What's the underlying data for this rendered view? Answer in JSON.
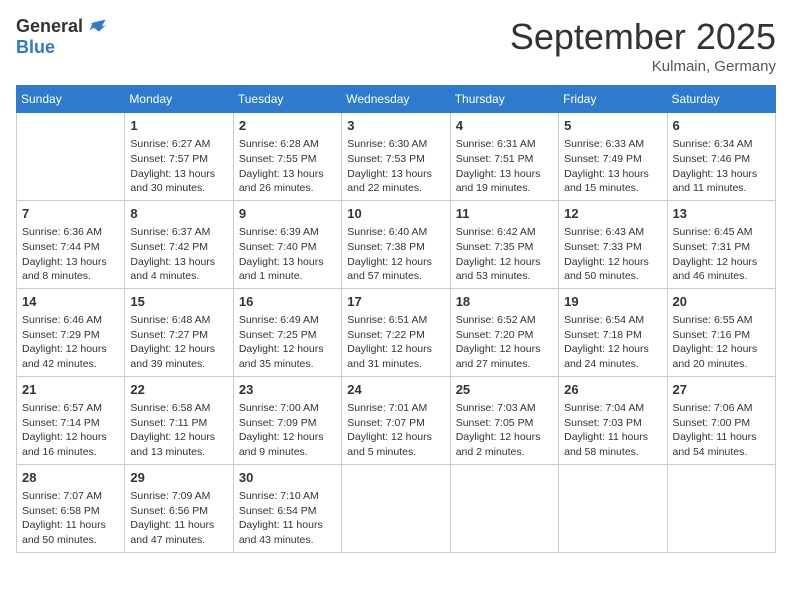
{
  "header": {
    "logo_general": "General",
    "logo_blue": "Blue",
    "month_title": "September 2025",
    "location": "Kulmain, Germany"
  },
  "weekdays": [
    "Sunday",
    "Monday",
    "Tuesday",
    "Wednesday",
    "Thursday",
    "Friday",
    "Saturday"
  ],
  "weeks": [
    [
      {
        "day": "",
        "info": ""
      },
      {
        "day": "1",
        "info": "Sunrise: 6:27 AM\nSunset: 7:57 PM\nDaylight: 13 hours and 30 minutes."
      },
      {
        "day": "2",
        "info": "Sunrise: 6:28 AM\nSunset: 7:55 PM\nDaylight: 13 hours and 26 minutes."
      },
      {
        "day": "3",
        "info": "Sunrise: 6:30 AM\nSunset: 7:53 PM\nDaylight: 13 hours and 22 minutes."
      },
      {
        "day": "4",
        "info": "Sunrise: 6:31 AM\nSunset: 7:51 PM\nDaylight: 13 hours and 19 minutes."
      },
      {
        "day": "5",
        "info": "Sunrise: 6:33 AM\nSunset: 7:49 PM\nDaylight: 13 hours and 15 minutes."
      },
      {
        "day": "6",
        "info": "Sunrise: 6:34 AM\nSunset: 7:46 PM\nDaylight: 13 hours and 11 minutes."
      }
    ],
    [
      {
        "day": "7",
        "info": "Sunrise: 6:36 AM\nSunset: 7:44 PM\nDaylight: 13 hours and 8 minutes."
      },
      {
        "day": "8",
        "info": "Sunrise: 6:37 AM\nSunset: 7:42 PM\nDaylight: 13 hours and 4 minutes."
      },
      {
        "day": "9",
        "info": "Sunrise: 6:39 AM\nSunset: 7:40 PM\nDaylight: 13 hours and 1 minute."
      },
      {
        "day": "10",
        "info": "Sunrise: 6:40 AM\nSunset: 7:38 PM\nDaylight: 12 hours and 57 minutes."
      },
      {
        "day": "11",
        "info": "Sunrise: 6:42 AM\nSunset: 7:35 PM\nDaylight: 12 hours and 53 minutes."
      },
      {
        "day": "12",
        "info": "Sunrise: 6:43 AM\nSunset: 7:33 PM\nDaylight: 12 hours and 50 minutes."
      },
      {
        "day": "13",
        "info": "Sunrise: 6:45 AM\nSunset: 7:31 PM\nDaylight: 12 hours and 46 minutes."
      }
    ],
    [
      {
        "day": "14",
        "info": "Sunrise: 6:46 AM\nSunset: 7:29 PM\nDaylight: 12 hours and 42 minutes."
      },
      {
        "day": "15",
        "info": "Sunrise: 6:48 AM\nSunset: 7:27 PM\nDaylight: 12 hours and 39 minutes."
      },
      {
        "day": "16",
        "info": "Sunrise: 6:49 AM\nSunset: 7:25 PM\nDaylight: 12 hours and 35 minutes."
      },
      {
        "day": "17",
        "info": "Sunrise: 6:51 AM\nSunset: 7:22 PM\nDaylight: 12 hours and 31 minutes."
      },
      {
        "day": "18",
        "info": "Sunrise: 6:52 AM\nSunset: 7:20 PM\nDaylight: 12 hours and 27 minutes."
      },
      {
        "day": "19",
        "info": "Sunrise: 6:54 AM\nSunset: 7:18 PM\nDaylight: 12 hours and 24 minutes."
      },
      {
        "day": "20",
        "info": "Sunrise: 6:55 AM\nSunset: 7:16 PM\nDaylight: 12 hours and 20 minutes."
      }
    ],
    [
      {
        "day": "21",
        "info": "Sunrise: 6:57 AM\nSunset: 7:14 PM\nDaylight: 12 hours and 16 minutes."
      },
      {
        "day": "22",
        "info": "Sunrise: 6:58 AM\nSunset: 7:11 PM\nDaylight: 12 hours and 13 minutes."
      },
      {
        "day": "23",
        "info": "Sunrise: 7:00 AM\nSunset: 7:09 PM\nDaylight: 12 hours and 9 minutes."
      },
      {
        "day": "24",
        "info": "Sunrise: 7:01 AM\nSunset: 7:07 PM\nDaylight: 12 hours and 5 minutes."
      },
      {
        "day": "25",
        "info": "Sunrise: 7:03 AM\nSunset: 7:05 PM\nDaylight: 12 hours and 2 minutes."
      },
      {
        "day": "26",
        "info": "Sunrise: 7:04 AM\nSunset: 7:03 PM\nDaylight: 11 hours and 58 minutes."
      },
      {
        "day": "27",
        "info": "Sunrise: 7:06 AM\nSunset: 7:00 PM\nDaylight: 11 hours and 54 minutes."
      }
    ],
    [
      {
        "day": "28",
        "info": "Sunrise: 7:07 AM\nSunset: 6:58 PM\nDaylight: 11 hours and 50 minutes."
      },
      {
        "day": "29",
        "info": "Sunrise: 7:09 AM\nSunset: 6:56 PM\nDaylight: 11 hours and 47 minutes."
      },
      {
        "day": "30",
        "info": "Sunrise: 7:10 AM\nSunset: 6:54 PM\nDaylight: 11 hours and 43 minutes."
      },
      {
        "day": "",
        "info": ""
      },
      {
        "day": "",
        "info": ""
      },
      {
        "day": "",
        "info": ""
      },
      {
        "day": "",
        "info": ""
      }
    ]
  ]
}
